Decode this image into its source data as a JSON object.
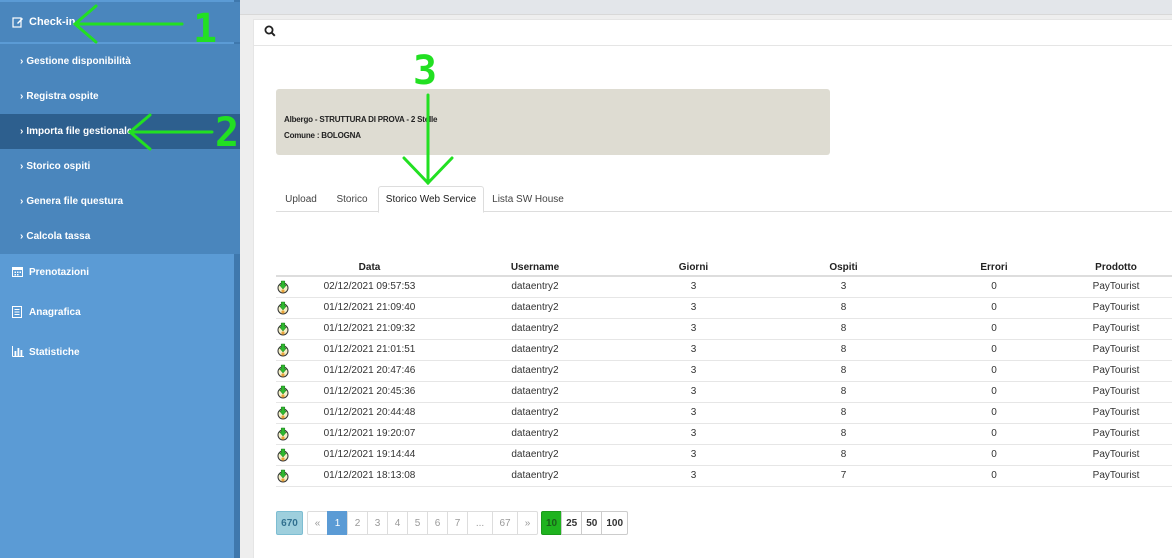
{
  "sidebar": {
    "checkin": "Check-in",
    "sub_items": [
      {
        "label": "Gestione disponibilità",
        "active": false
      },
      {
        "label": "Registra ospite",
        "active": false
      },
      {
        "label": "Importa file gestionale",
        "active": true
      },
      {
        "label": "Storico ospiti",
        "active": false
      },
      {
        "label": "Genera file questura",
        "active": false
      },
      {
        "label": "Calcola tassa",
        "active": false
      }
    ],
    "prenotazioni": "Prenotazioni",
    "anagrafica": "Anagrafica",
    "statistiche": "Statistiche",
    "icons": [
      "edit-icon",
      "calendar-icon",
      "document-icon",
      "bar-chart-icon"
    ]
  },
  "search": {
    "icon": "search-icon"
  },
  "hotel": {
    "line1": "Albergo - STRUTTURA DI PROVA - 2 Stelle",
    "line2": "Comune : BOLOGNA"
  },
  "tabs": [
    "Upload",
    "Storico",
    "Storico Web Service",
    "Lista SW House"
  ],
  "active_tab": "Storico Web Service",
  "table": {
    "headers": [
      "Data",
      "Username",
      "Giorni",
      "Ospiti",
      "Errori",
      "Prodotto"
    ],
    "rows": [
      [
        "02/12/2021 09:57:53",
        "dataentry2",
        "3",
        "3",
        "0",
        "PayTourist"
      ],
      [
        "01/12/2021 21:09:40",
        "dataentry2",
        "3",
        "8",
        "0",
        "PayTourist"
      ],
      [
        "01/12/2021 21:09:32",
        "dataentry2",
        "3",
        "8",
        "0",
        "PayTourist"
      ],
      [
        "01/12/2021 21:01:51",
        "dataentry2",
        "3",
        "8",
        "0",
        "PayTourist"
      ],
      [
        "01/12/2021 20:47:46",
        "dataentry2",
        "3",
        "8",
        "0",
        "PayTourist"
      ],
      [
        "01/12/2021 20:45:36",
        "dataentry2",
        "3",
        "8",
        "0",
        "PayTourist"
      ],
      [
        "01/12/2021 20:44:48",
        "dataentry2",
        "3",
        "8",
        "0",
        "PayTourist"
      ],
      [
        "01/12/2021 19:20:07",
        "dataentry2",
        "3",
        "8",
        "0",
        "PayTourist"
      ],
      [
        "01/12/2021 19:14:44",
        "dataentry2",
        "3",
        "8",
        "0",
        "PayTourist"
      ],
      [
        "01/12/2021 18:13:08",
        "dataentry2",
        "3",
        "7",
        "0",
        "PayTourist"
      ]
    ]
  },
  "pagination": {
    "total": "670",
    "prev": "«",
    "pages": [
      "1",
      "2",
      "3",
      "4",
      "5",
      "6",
      "7",
      "...",
      "67"
    ],
    "next": "»",
    "current": "1",
    "sizes": [
      "10",
      "25",
      "50",
      "100"
    ],
    "selected_size": "10"
  },
  "annotations": [
    "1",
    "2",
    "3"
  ],
  "colors": {
    "sidebar": "#5b9bd5",
    "active_item": "#2d5f8e",
    "annotation": "#22e022",
    "page_size_selected": "#1fb31f"
  }
}
